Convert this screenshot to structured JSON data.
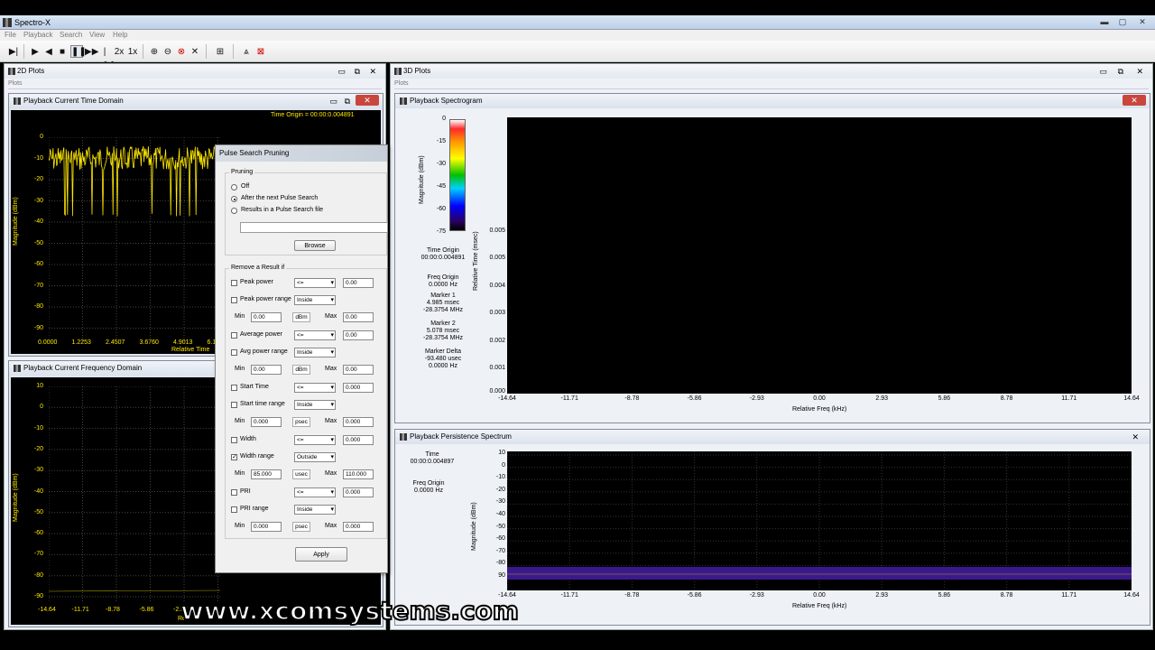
{
  "app": {
    "title": "Spectro-X"
  },
  "menu": [
    "File",
    "Playback",
    "Search",
    "View",
    "Help"
  ],
  "toolbar": {
    "icons": [
      "play-step-icon",
      "play-icon",
      "rewind-icon",
      "stop-icon",
      "pause-icon",
      "fast-forward-icon",
      "skip-back-icon",
      "speed-2x-icon",
      "speed-1x-icon",
      "zoom-in-icon",
      "zoom-out-icon",
      "zoom-reset-icon",
      "zoom-fit-icon",
      "grid-icon",
      "pulse-search-icon",
      "pulse-delete-icon"
    ],
    "speed2": "2x",
    "speed1": "1x"
  },
  "panes": {
    "left_title": "2D Plots",
    "right_title": "3D Plots",
    "plots_label": "Plots"
  },
  "time_domain": {
    "title": "Playback Current Time Domain",
    "time_origin": "Time Origin = 00:00:0.004891",
    "ylabel": "Magnitude (dBm)",
    "xlabel": "Relative Time",
    "yticks": [
      "0",
      "-10",
      "-20",
      "-30",
      "-40",
      "-50",
      "-60",
      "-70",
      "-80",
      "-90"
    ],
    "xticks": [
      "0.0000",
      "1.2253",
      "2.4507",
      "3.6760",
      "4.9013",
      "6.1267"
    ]
  },
  "freq_domain": {
    "title": "Playback Current Frequency Domain",
    "ylabel": "Magnitude (dBm)",
    "yticks": [
      "10",
      "0",
      "-10",
      "-20",
      "-30",
      "-40",
      "-50",
      "-60",
      "-70",
      "-80",
      "-90"
    ],
    "xticks": [
      "-14.64",
      "-11.71",
      "-8.78",
      "-5.86",
      "-2.93"
    ],
    "xlabel_partial": "Re"
  },
  "dialog": {
    "title": "Pulse Search Pruning",
    "pruning_label": "Pruning",
    "radio_off": "Off",
    "radio_next": "After the next Pulse Search",
    "radio_file": "Results in a Pulse Search file",
    "file_path": "",
    "browse": "Browse",
    "remove_label": "Remove a Result if",
    "rows": [
      {
        "label": "Peak power",
        "checked": false,
        "op": "<=",
        "value": "0.00"
      },
      {
        "label": "Peak power range",
        "checked": false,
        "op": "Inside",
        "min": "0.00",
        "unit": "dBm",
        "max": "0.00"
      },
      {
        "label": "Average power",
        "checked": false,
        "op": "<=",
        "value": "0.00"
      },
      {
        "label": "Avg power range",
        "checked": false,
        "op": "Inside",
        "min": "0.00",
        "unit": "dBm",
        "max": "0.00"
      },
      {
        "label": "Start Time",
        "checked": false,
        "op": "<=",
        "value": "0.000"
      },
      {
        "label": "Start time range",
        "checked": false,
        "op": "Inside",
        "min": "0.000",
        "unit": "psec",
        "max": "0.000"
      },
      {
        "label": "Width",
        "checked": false,
        "op": "<=",
        "value": "0.000"
      },
      {
        "label": "Width range",
        "checked": true,
        "op": "Outside",
        "min": "85.000",
        "unit": "usec",
        "max": "110.000"
      },
      {
        "label": "PRI",
        "checked": false,
        "op": "<=",
        "value": "0.000"
      },
      {
        "label": "PRI range",
        "checked": false,
        "op": "Inside",
        "min": "0.000",
        "unit": "psec",
        "max": "0.000"
      }
    ],
    "min_label": "Min",
    "max_label": "Max",
    "apply": "Apply"
  },
  "spectrogram": {
    "title": "Playback Spectrogram",
    "colorbar_label": "Magnitude (dBm)",
    "colorbar_ticks": [
      "0",
      "-15",
      "-30",
      "-45",
      "-60",
      "-75"
    ],
    "info": {
      "time_origin_label": "Time Origin",
      "time_origin": "00:00:0.004891",
      "freq_origin_label": "Freq Origin",
      "freq_origin": "0.0000 Hz",
      "marker1_label": "Marker 1",
      "marker1_t": "4.985 msec",
      "marker1_f": "-28.3754 MHz",
      "marker2_label": "Marker 2",
      "marker2_t": "5.078 msec",
      "marker2_f": "-28.3754 MHz",
      "delta_label": "Marker Delta",
      "delta_t": "-93.480 usec",
      "delta_f": "0.0000 Hz"
    },
    "ylabel": "Relative Time (msec)",
    "yticks": [
      "0.005",
      "0.005",
      "0.004",
      "0.003",
      "0.002",
      "0.001",
      "0.000"
    ],
    "xticks": [
      "-14.64",
      "-11.71",
      "-8.78",
      "-5.86",
      "-2.93",
      "0.00",
      "2.93",
      "5.86",
      "8.78",
      "11.71",
      "14.64"
    ],
    "xlabel": "Relative Freq (kHz)"
  },
  "persistence": {
    "title": "Playback Persistence Spectrum",
    "time_label": "Time",
    "time": "00:00:0.004897",
    "freq_origin_label": "Freq Origin",
    "freq_origin": "0.0000 Hz",
    "ylabel": "Magnitude (dBm)",
    "yticks": [
      "10",
      "0",
      "-10",
      "-20",
      "-30",
      "-40",
      "-50",
      "-60",
      "-70",
      "-80",
      "90"
    ],
    "xticks": [
      "-14.64",
      "-11.71",
      "-8.78",
      "-5.86",
      "-2.93",
      "0.00",
      "2.93",
      "5.86",
      "8.78",
      "11.71",
      "14.64"
    ],
    "xlabel": "Relative Freq (kHz)"
  },
  "watermark": "www.xcomsystems.com",
  "colors": {
    "trace": "#ffe800",
    "persistence": "#3a1a8a",
    "close": "#c9463d"
  }
}
